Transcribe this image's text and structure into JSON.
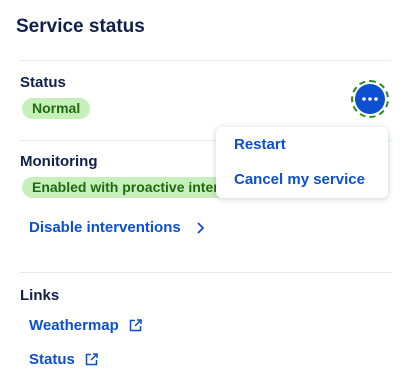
{
  "page": {
    "title": "Service status"
  },
  "status": {
    "label": "Status",
    "badge": "Normal"
  },
  "actions_menu": {
    "items": [
      {
        "label": "Restart"
      },
      {
        "label": "Cancel my service"
      }
    ]
  },
  "monitoring": {
    "label": "Monitoring",
    "badge": "Enabled with proactive interventions",
    "disable_link": "Disable interventions"
  },
  "links": {
    "label": "Links",
    "items": [
      {
        "label": "Weathermap",
        "icon": "external-link-icon"
      },
      {
        "label": "Status",
        "icon": "external-link-icon"
      }
    ]
  },
  "colors": {
    "accent": "#0c4fd0",
    "badge_background": "#c7efb9",
    "badge_text": "#1e6b11",
    "focus_ring": "#2a8b1d"
  }
}
